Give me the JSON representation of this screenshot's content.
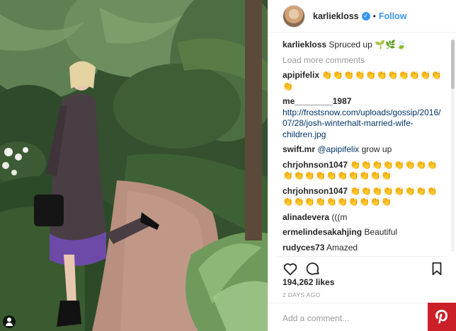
{
  "post": {
    "username": "karliekloss",
    "follow_label": "Follow",
    "separator": "•",
    "verified_glyph": "✓"
  },
  "caption": {
    "username": "karliekloss",
    "text": "Spruced up",
    "emoji": "🌱🌿🍃"
  },
  "load_more": "Load more comments",
  "comments": [
    {
      "user": "apipifelix",
      "text": "👏👏👏👏👏👏👏👏👏👏👏👏"
    },
    {
      "user": "me________1987",
      "text": "http://frostsnow.com/uploads/gossip/2016/07/28/josh-winterhalt-married-wife-children.jpg"
    },
    {
      "user": "swift.mr",
      "mention": "@apipifelix",
      "text": "grow up"
    },
    {
      "user": "chrjohnson1047",
      "text": "👏👏👏👏👏👏👏👏👏👏👏👏👏👏👏👏👏👏"
    },
    {
      "user": "chrjohnson1047",
      "text": "👏👏👏👏👏👏👏👏👏👏👏👏👏👏👏👏👏👏"
    },
    {
      "user": "alinadevera",
      "text": "(((m"
    },
    {
      "user": "ermelindesakahjing",
      "text": "Beautiful"
    },
    {
      "user": "rudyces73",
      "text": "Amazed"
    }
  ],
  "stats": {
    "likes": "194,262 likes",
    "time": "2 DAYS AGO"
  },
  "composer": {
    "placeholder": "Add a comment..."
  },
  "icons": {
    "like": "heart-icon",
    "comment": "comment-icon",
    "save": "bookmark-icon",
    "pinterest": "pinterest-icon",
    "user_tag": "user-tag-icon"
  },
  "colors": {
    "link_blue": "#3897f0",
    "pinterest_red": "#cb2027",
    "muted": "#999999"
  }
}
